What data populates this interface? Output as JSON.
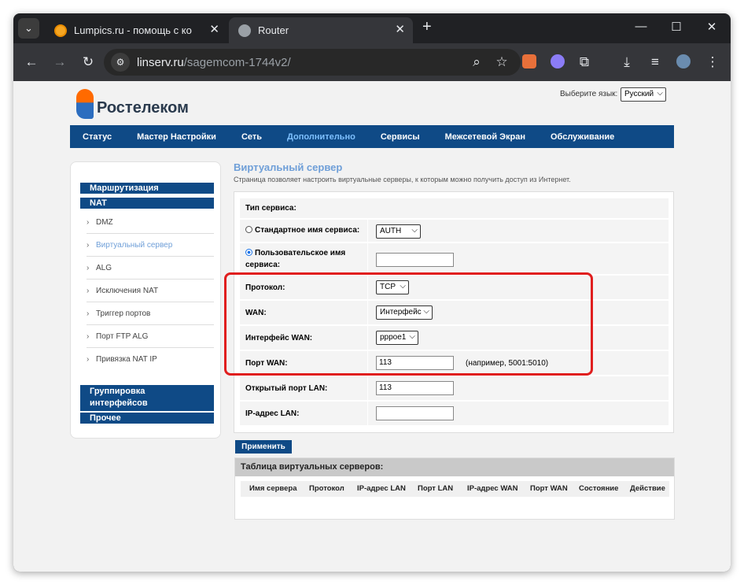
{
  "browser": {
    "tabs": [
      {
        "title": "Lumpics.ru - помощь с компь",
        "active": false
      },
      {
        "title": "Router",
        "active": true
      }
    ],
    "url_host": "linserv.ru",
    "url_path": "/sagemcom-1744v2/"
  },
  "header": {
    "brand": "Ростелеком",
    "lang_label": "Выберите язык:",
    "lang_value": "Русский"
  },
  "nav": {
    "items": [
      "Статус",
      "Мастер Настройки",
      "Сеть",
      "Дополнительно",
      "Сервисы",
      "Межсетевой Экран",
      "Обслуживание"
    ],
    "active": "Дополнительно"
  },
  "sidebar": {
    "section1": "Маршрутизация",
    "section2": "NAT",
    "items": [
      "DMZ",
      "Виртуальный сервер",
      "ALG",
      "Исключения NAT",
      "Триггер портов",
      "Порт FTP ALG",
      "Привязка NAT IP"
    ],
    "active_item": "Виртуальный сервер",
    "section3": "Группировка интерфейсов",
    "section4": "Прочее"
  },
  "content": {
    "title": "Виртуальный сервер",
    "description": "Страница позволяет настроить виртуальные серверы, к которым можно получить доступ из Интернет.",
    "service_type_label": "Тип сервиса:",
    "standard_name_label": "Стандартное имя сервиса:",
    "standard_name_value": "AUTH",
    "custom_name_label_1": "Пользовательское имя",
    "custom_name_label_2": "сервиса:",
    "custom_name_value": "",
    "protocol_label": "Протокол:",
    "protocol_value": "TCP",
    "wan_label": "WAN:",
    "wan_value": "Интерфейс",
    "wan_interface_label": "Интерфейс WAN:",
    "wan_interface_value": "pppoe1",
    "wan_port_label": "Порт WAN:",
    "wan_port_value": "113",
    "wan_port_hint": "(например, 5001:5010)",
    "lan_port_label": "Открытый порт LAN:",
    "lan_port_value": "113",
    "lan_ip_label": "IP-адрес LAN:",
    "lan_ip_value": "",
    "apply_label": "Применить"
  },
  "vs_table": {
    "title": "Таблица виртуальных серверов:",
    "columns": [
      "Имя сервера",
      "Протокол",
      "IP-адрес LAN",
      "Порт LAN",
      "IP-адрес WAN",
      "Порт WAN",
      "Состояние",
      "Действие"
    ]
  }
}
